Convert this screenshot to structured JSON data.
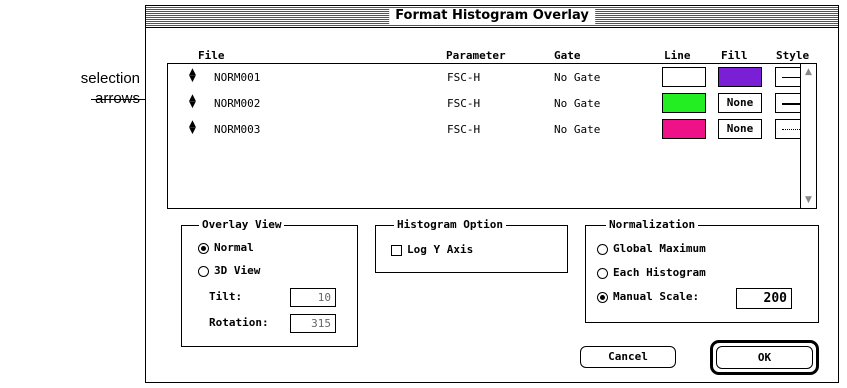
{
  "callout": {
    "line1": "selection",
    "line2": "arrows"
  },
  "window": {
    "title": "Format Histogram Overlay"
  },
  "columns": {
    "file": "File",
    "parameter": "Parameter",
    "gate": "Gate",
    "line": "Line",
    "fill": "Fill",
    "style": "Style"
  },
  "rows": [
    {
      "file": "NORM001",
      "parameter": "FSC-H",
      "gate": "No Gate",
      "line_color": "#ffffff",
      "fill_color": "#7a1fd6",
      "fill_label": "",
      "style": "solid-thin"
    },
    {
      "file": "NORM002",
      "parameter": "FSC-H",
      "gate": "No Gate",
      "line_color": "#22ee22",
      "fill_color": "#ffffff",
      "fill_label": "None",
      "style": "solid-thick"
    },
    {
      "file": "NORM003",
      "parameter": "FSC-H",
      "gate": "No Gate",
      "line_color": "#ee1188",
      "fill_color": "#ffffff",
      "fill_label": "None",
      "style": "dotted"
    }
  ],
  "overlay_view": {
    "label": "Overlay View",
    "normal": "Normal",
    "view3d": "3D View",
    "selected": "Normal",
    "tilt_label": "Tilt:",
    "tilt_value": "10",
    "rotation_label": "Rotation:",
    "rotation_value": "315"
  },
  "histogram_option": {
    "label": "Histogram Option",
    "log_y": "Log Y Axis",
    "log_y_checked": false
  },
  "normalization": {
    "label": "Normalization",
    "global_max": "Global Maximum",
    "each_histogram": "Each Histogram",
    "manual_scale": "Manual Scale:",
    "manual_value": "200",
    "selected": "Manual Scale:"
  },
  "buttons": {
    "cancel": "Cancel",
    "ok": "OK"
  }
}
